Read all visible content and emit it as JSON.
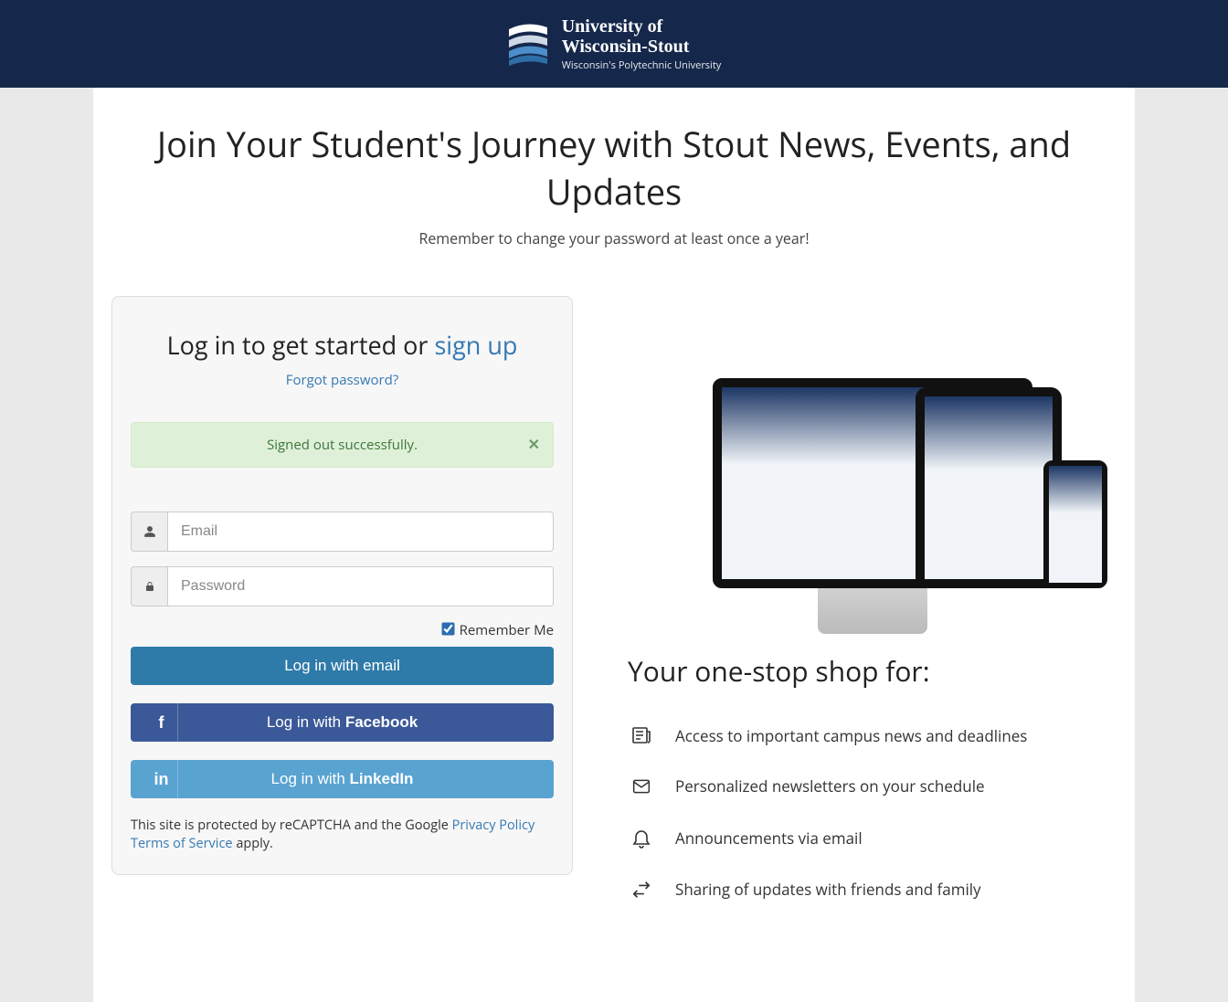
{
  "header": {
    "brand_line1": "University of",
    "brand_line2": "Wisconsin-Stout",
    "brand_sub": "Wisconsin's Polytechnic University"
  },
  "hero": {
    "title": "Join Your Student's Journey with Stout News, Events, and Updates",
    "subtitle": "Remember to change your password at least once a year!"
  },
  "login": {
    "heading_prefix": "Log in to get started or ",
    "signup_label": "sign up",
    "forgot_label": "Forgot password?",
    "alert_text": "Signed out successfully.",
    "email_placeholder": "Email",
    "password_placeholder": "Password",
    "remember_label": "Remember Me",
    "remember_checked": true,
    "btn_email": "Log in with email",
    "btn_fb_prefix": "Log in with ",
    "btn_fb_brand": "Facebook",
    "btn_li_prefix": "Log in with ",
    "btn_li_brand": "LinkedIn",
    "recaptcha_prefix": "This site is protected by reCAPTCHA and the Google ",
    "recaptcha_privacy": "Privacy Policy",
    "recaptcha_mid": " ",
    "recaptcha_terms": "Terms of Service",
    "recaptcha_suffix": " apply."
  },
  "info": {
    "heading": "Your one-stop shop for:",
    "features": [
      "Access to important campus news and deadlines",
      "Personalized newsletters on your schedule",
      "Announcements via email",
      "Sharing of updates with friends and family"
    ]
  }
}
